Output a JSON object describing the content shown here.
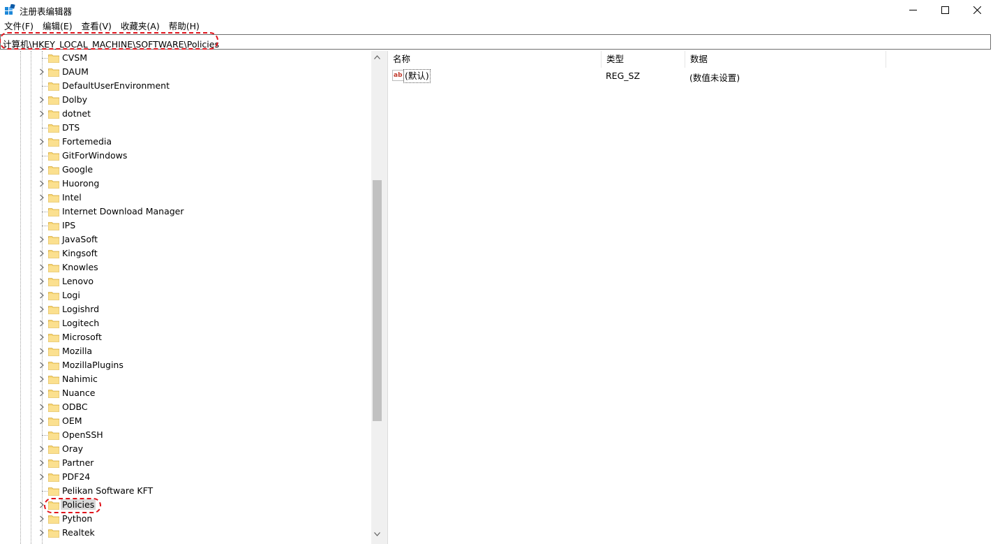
{
  "window": {
    "title": "注册表编辑器",
    "controls": {
      "minimize": "minimize-icon",
      "maximize": "maximize-icon",
      "close": "close-icon"
    }
  },
  "menu": [
    "文件(F)",
    "编辑(E)",
    "查看(V)",
    "收藏夹(A)",
    "帮助(H)"
  ],
  "address": "计算机\\HKEY_LOCAL_MACHINE\\SOFTWARE\\Policies",
  "tree": {
    "items": [
      {
        "label": "CVSM",
        "expandable": false
      },
      {
        "label": "DAUM",
        "expandable": true
      },
      {
        "label": "DefaultUserEnvironment",
        "expandable": false
      },
      {
        "label": "Dolby",
        "expandable": true
      },
      {
        "label": "dotnet",
        "expandable": true
      },
      {
        "label": "DTS",
        "expandable": false
      },
      {
        "label": "Fortemedia",
        "expandable": true
      },
      {
        "label": "GitForWindows",
        "expandable": false
      },
      {
        "label": "Google",
        "expandable": true
      },
      {
        "label": "Huorong",
        "expandable": true
      },
      {
        "label": "Intel",
        "expandable": true
      },
      {
        "label": "Internet Download Manager",
        "expandable": false
      },
      {
        "label": "IPS",
        "expandable": false
      },
      {
        "label": "JavaSoft",
        "expandable": true
      },
      {
        "label": "Kingsoft",
        "expandable": true
      },
      {
        "label": "Knowles",
        "expandable": true
      },
      {
        "label": "Lenovo",
        "expandable": true
      },
      {
        "label": "Logi",
        "expandable": true
      },
      {
        "label": "Logishrd",
        "expandable": true
      },
      {
        "label": "Logitech",
        "expandable": true
      },
      {
        "label": "Microsoft",
        "expandable": true
      },
      {
        "label": "Mozilla",
        "expandable": true
      },
      {
        "label": "MozillaPlugins",
        "expandable": true
      },
      {
        "label": "Nahimic",
        "expandable": true
      },
      {
        "label": "Nuance",
        "expandable": true
      },
      {
        "label": "ODBC",
        "expandable": true
      },
      {
        "label": "OEM",
        "expandable": true
      },
      {
        "label": "OpenSSH",
        "expandable": false
      },
      {
        "label": "Oray",
        "expandable": true
      },
      {
        "label": "Partner",
        "expandable": true
      },
      {
        "label": "PDF24",
        "expandable": true
      },
      {
        "label": "Pelikan Software KFT",
        "expandable": false
      },
      {
        "label": "Policies",
        "expandable": true,
        "selected": true
      },
      {
        "label": "Python",
        "expandable": true
      },
      {
        "label": "Realtek",
        "expandable": true
      }
    ]
  },
  "list": {
    "columns": [
      "名称",
      "类型",
      "数据"
    ],
    "rows": [
      {
        "name": "(默认)",
        "type": "REG_SZ",
        "data": "(数值未设置)"
      }
    ]
  },
  "colors": {
    "highlight": "#e0131b",
    "selection": "#d9d9d9",
    "folder": "#f8d775"
  }
}
